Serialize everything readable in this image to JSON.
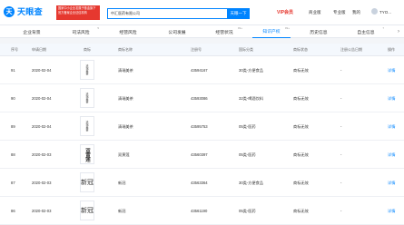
{
  "header": {
    "logo_char": "天",
    "logo_text": "天眼查",
    "promo_text": "国家中小企业发展子基金旗下 官方备案企业征信机构",
    "search_value": "中汇医药有限公司",
    "search_button": "天眼一下",
    "vip_label": "VIP会员",
    "nav_brand": "商业版",
    "nav_pro": "专业版",
    "nav_app": "我的",
    "nav_user": "TYO..."
  },
  "tabs": [
    {
      "label": "企业背景",
      "count": ""
    },
    {
      "label": "司法风险",
      "count": "5"
    },
    {
      "label": "经营风险",
      "count": ""
    },
    {
      "label": "公司发展",
      "count": ""
    },
    {
      "label": "经营状况",
      "count": "99+"
    },
    {
      "label": "知识产权",
      "count": "99+"
    },
    {
      "label": "历史信息",
      "count": ""
    },
    {
      "label": "自主信息",
      "count": "7"
    }
  ],
  "table": {
    "headers": [
      "序号",
      "申请日期",
      "商标",
      "商标名称",
      "注册号",
      "国际分类",
      "商标状态",
      "注册公告日期",
      "操作"
    ],
    "rows": [
      {
        "no": "91",
        "date": "2020-02-04",
        "mark": "清瑞美茶",
        "mark_style": "tiny",
        "name": "清瑞美茶",
        "reg": "43594167",
        "cls": "30类-方便食品",
        "status": "商标无效",
        "pub": "-",
        "op": "详情"
      },
      {
        "no": "90",
        "date": "2020-02-04",
        "mark": "清瑞美茶",
        "mark_style": "tiny",
        "name": "清瑞美茶",
        "reg": "43593086",
        "cls": "32类-啤酒饮料",
        "status": "商标无效",
        "pub": "-",
        "op": "详情"
      },
      {
        "no": "89",
        "date": "2020-02-04",
        "mark": "清瑞美茶",
        "mark_style": "tiny",
        "name": "清瑞美茶",
        "reg": "43595753",
        "cls": "05类-医药",
        "status": "商标无效",
        "pub": "-",
        "op": "详情"
      },
      {
        "no": "88",
        "date": "2020-02-03",
        "mark": "双黄莲",
        "mark_style": "bold",
        "name": "双黄莲",
        "reg": "43560397",
        "cls": "05类-医药",
        "status": "商标无效",
        "pub": "-",
        "op": "详情"
      },
      {
        "no": "87",
        "date": "2020-02-03",
        "mark": "新冠",
        "mark_style": "chinese",
        "name": "新冠",
        "reg": "43563364",
        "cls": "30类-方便食品",
        "status": "商标无效",
        "pub": "-",
        "op": "详情"
      },
      {
        "no": "86",
        "date": "2020-02-03",
        "mark": "新冠",
        "mark_style": "chinese",
        "name": "新冠",
        "reg": "43561190",
        "cls": "05类-医药",
        "status": "商标无效",
        "pub": "-",
        "op": "详情"
      }
    ]
  },
  "colors": {
    "accent": "#0084ff",
    "vip": "#e6382f"
  },
  "icons": {
    "search_button": "search-icon",
    "tab_more": "chevron-right-icon"
  }
}
